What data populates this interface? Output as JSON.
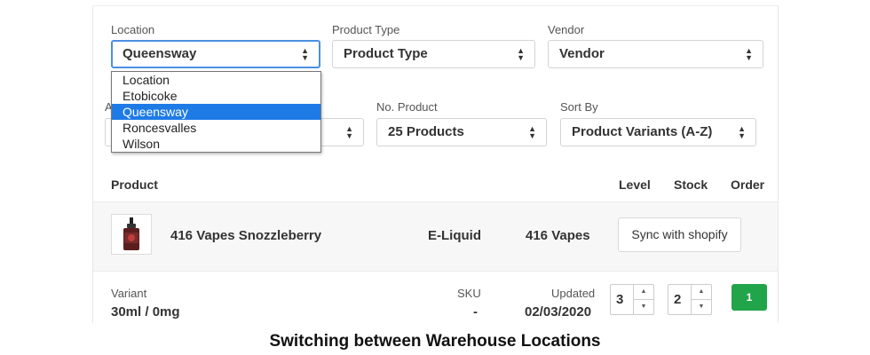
{
  "filters": {
    "location": {
      "label": "Location",
      "value": "Queensway"
    },
    "product_type": {
      "label": "Product Type",
      "value": "Product Type"
    },
    "vendor": {
      "label": "Vendor",
      "value": "Vendor"
    },
    "hidden_label_fragment": "A",
    "no_product": {
      "label": "No. Product",
      "value": "25 Products"
    },
    "sort_by": {
      "label": "Sort By",
      "value": "Product Variants (A-Z)"
    }
  },
  "location_dropdown": {
    "options": [
      "Location",
      "Etobicoke",
      "Queensway",
      "Roncesvalles",
      "Wilson"
    ],
    "highlighted": "Queensway"
  },
  "table_header": {
    "product": "Product",
    "level": "Level",
    "stock": "Stock",
    "order": "Order"
  },
  "product": {
    "name": "416 Vapes Snozzleberry",
    "type": "E-Liquid",
    "vendor": "416 Vapes",
    "sync_label": "Sync with shopify"
  },
  "variant": {
    "variant_label": "Variant",
    "variant_value": "30ml / 0mg",
    "sku_label": "SKU",
    "sku_value": "-",
    "updated_label": "Updated",
    "updated_value": "02/03/2020",
    "level_value": "3",
    "stock_value": "2",
    "order_value": "1"
  },
  "caption": "Switching between Warehouse Locations",
  "colors": {
    "accent_blue": "#1e7be6",
    "focus_border": "#4a90e2",
    "order_green": "#22a44a"
  },
  "icons": {
    "select_caret": "updown-caret-icon",
    "stepper_up": "chevron-up-icon",
    "stepper_down": "chevron-down-icon",
    "product_thumbnail": "eliquid-bottle-icon"
  }
}
